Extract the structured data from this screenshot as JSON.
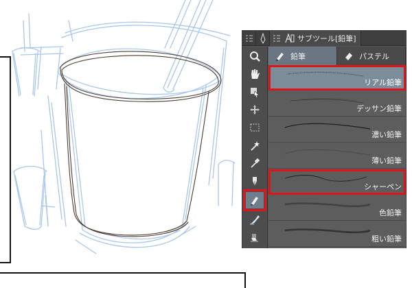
{
  "panel": {
    "title": "サブツール[鉛筆]",
    "groups": [
      {
        "label": "鉛筆",
        "active": true,
        "icon": "pencil-icon"
      },
      {
        "label": "パステル",
        "active": false,
        "icon": "pastel-icon"
      }
    ],
    "brushes": [
      {
        "label": "リアル鉛筆",
        "selected": true,
        "highlighted": true
      },
      {
        "label": "デッサン鉛筆",
        "selected": false,
        "highlighted": false
      },
      {
        "label": "濃い鉛筆",
        "selected": false,
        "highlighted": false
      },
      {
        "label": "薄い鉛筆",
        "selected": false,
        "highlighted": false
      },
      {
        "label": "シャーペン",
        "selected": false,
        "highlighted": true
      },
      {
        "label": "色鉛筆",
        "selected": false,
        "highlighted": false
      },
      {
        "label": "粗い鉛筆",
        "selected": false,
        "highlighted": false
      }
    ],
    "tools": [
      "zoom-icon",
      "hand-icon",
      "operation-icon",
      "move-layer-icon",
      "selection-icon",
      "auto-select-icon",
      "eyedropper-icon",
      "pen-icon",
      "pencil-icon",
      "brush-icon",
      "eraser-icon"
    ],
    "selected_tool": "pencil-icon"
  },
  "colors": {
    "highlight": "#e0141b",
    "sketch_blue": "#a9c7ea",
    "sketch_dark": "#4a3b30"
  }
}
